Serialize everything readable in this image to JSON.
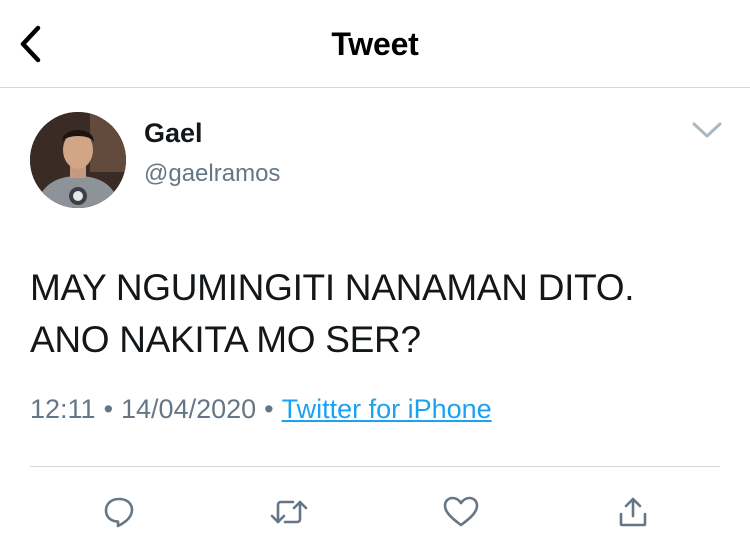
{
  "header": {
    "title": "Tweet",
    "back_icon": "chevron-left-icon"
  },
  "tweet": {
    "author": {
      "name": "Gael",
      "handle": "@gaelramos",
      "avatar": "avatar-photo"
    },
    "text_lines": [
      "MAY NGUMINGITI NANAMAN DITO.",
      "ANO NAKITA MO SER?"
    ],
    "time": "12:11",
    "separator": "•",
    "date": "14/04/2020",
    "source": "Twitter for iPhone"
  },
  "actions": [
    {
      "icon": "reply-icon"
    },
    {
      "icon": "retweet-icon"
    },
    {
      "icon": "like-icon"
    },
    {
      "icon": "share-icon"
    }
  ],
  "colors": {
    "link": "#1da1f2",
    "secondary_text": "#657786",
    "icon": "#657786",
    "divider": "#d4d8dc"
  }
}
